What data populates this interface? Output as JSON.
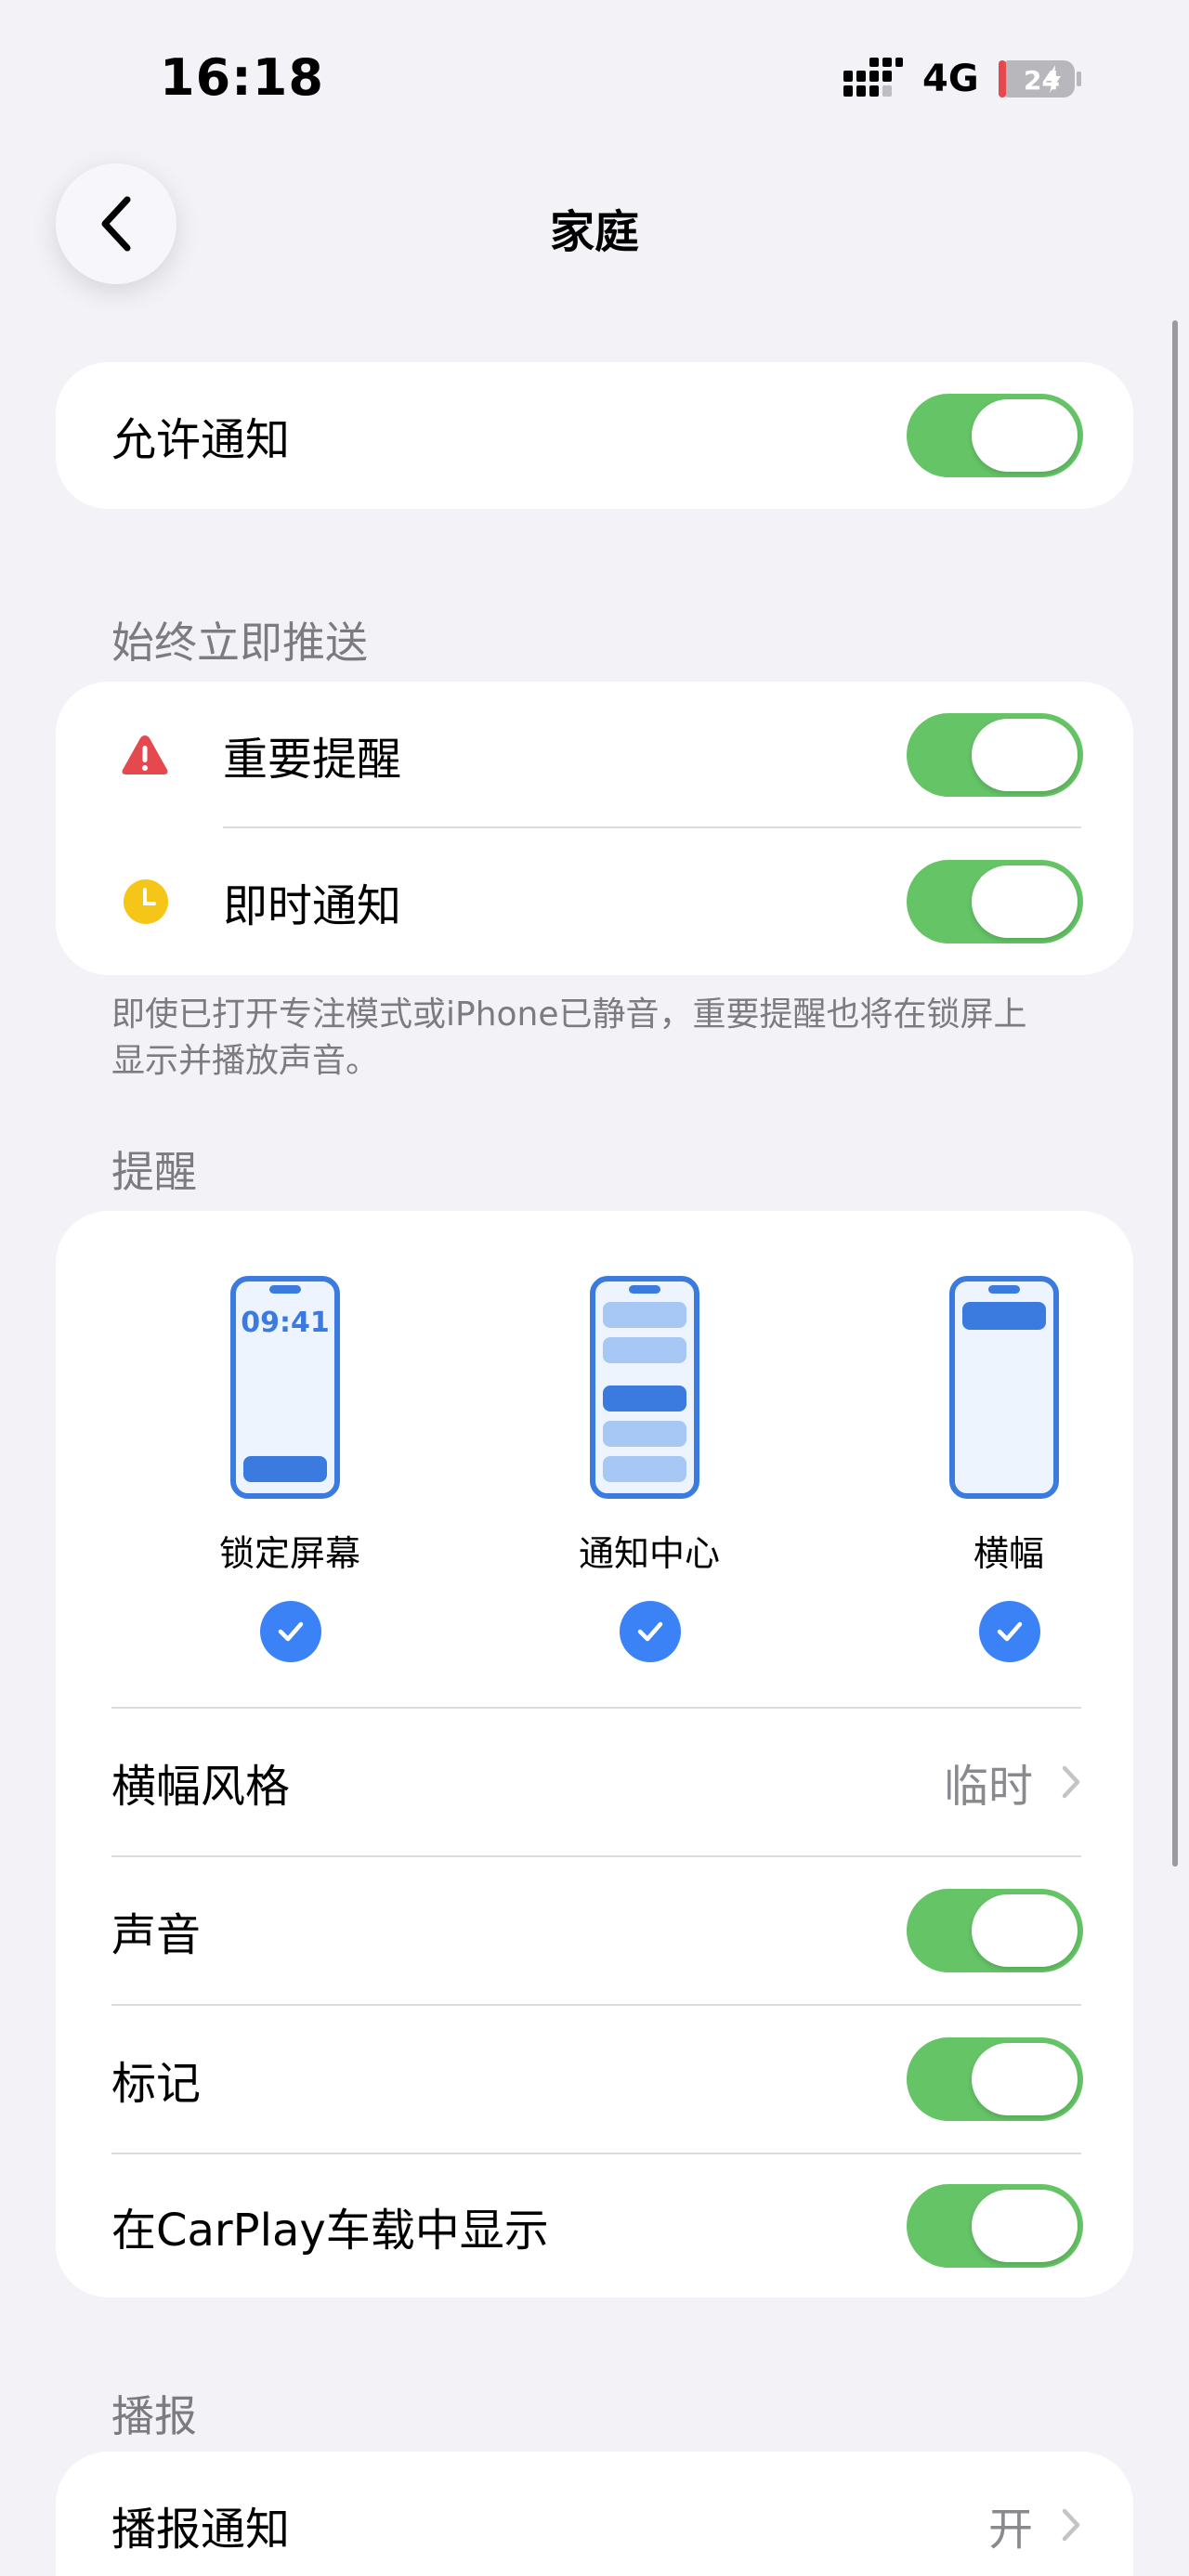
{
  "status_bar": {
    "time": "16:18",
    "network": "4G",
    "battery_level": "24"
  },
  "nav": {
    "title": "家庭",
    "back_icon": "chevron-left-icon"
  },
  "allow_notifications": {
    "label": "允许通知",
    "on": true
  },
  "immediate_section": {
    "header": "始终立即推送",
    "items": [
      {
        "label": "重要提醒",
        "icon": "warning-triangle-icon",
        "icon_color": "#e5484d",
        "on": true
      },
      {
        "label": "即时通知",
        "icon": "clock-icon",
        "icon_color": "#f5c518",
        "on": true
      }
    ],
    "footnote": "即使已打开专注模式或iPhone已静音，重要提醒也将在锁屏上显示并播放声音。"
  },
  "alerts_section": {
    "header": "提醒",
    "styles": [
      {
        "label": "锁定屏幕",
        "phone_time": "09:41",
        "checked": true
      },
      {
        "label": "通知中心",
        "checked": true
      },
      {
        "label": "横幅",
        "checked": true
      }
    ],
    "rows": [
      {
        "label": "横幅风格",
        "value": "临时"
      },
      {
        "label": "声音",
        "on": true
      },
      {
        "label": "标记",
        "on": true
      },
      {
        "label": "在CarPlay车载中显示",
        "on": true
      }
    ]
  },
  "announce_section": {
    "header": "播报",
    "rows": [
      {
        "label": "播报通知",
        "value": "开"
      }
    ]
  },
  "colors": {
    "toggle_on": "#65c466",
    "accent": "#3b82f6",
    "background": "#f2f2f7"
  }
}
